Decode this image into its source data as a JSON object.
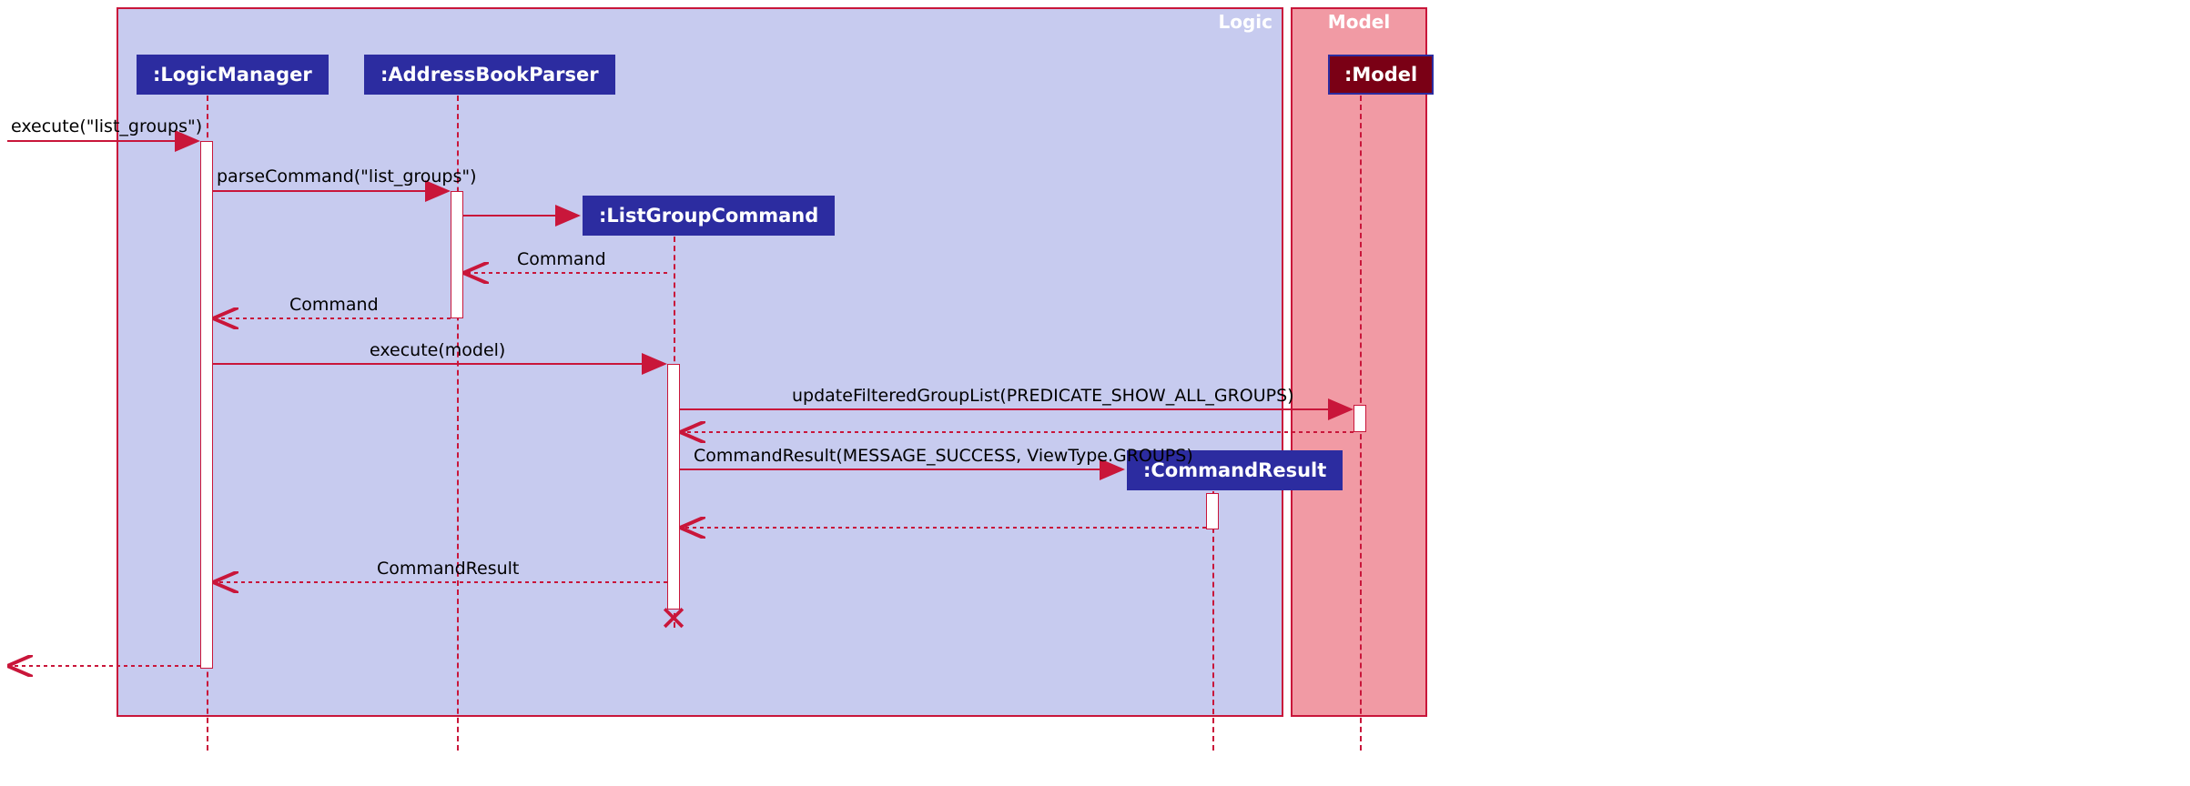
{
  "frames": {
    "logic": {
      "label": "Logic"
    },
    "model": {
      "label": "Model"
    }
  },
  "participants": {
    "logicManager": ":LogicManager",
    "addressBookParser": ":AddressBookParser",
    "listGroupCommand": ":ListGroupCommand",
    "commandResult": ":CommandResult",
    "model": ":Model"
  },
  "messages": {
    "executeListGroups": "execute(\"list_groups\")",
    "parseCommand": "parseCommand(\"list_groups\")",
    "returnCommand1": "Command",
    "returnCommand2": "Command",
    "executeModel": "execute(model)",
    "updateFilteredGroupList": "updateFilteredGroupList(PREDICATE_SHOW_ALL_GROUPS)",
    "createCommandResult": "CommandResult(MESSAGE_SUCCESS, ViewType.GROUPS)",
    "returnCommandResult": "CommandResult"
  },
  "colors": {
    "logicStroke": "#c9163a",
    "logicFill": "#c7cbef",
    "modelStroke": "#c9163a",
    "modelFill": "#f19aa4",
    "participantBg": "#2c2ca0",
    "modelHeadBg": "#7a0015",
    "arrow": "#c9163a"
  }
}
